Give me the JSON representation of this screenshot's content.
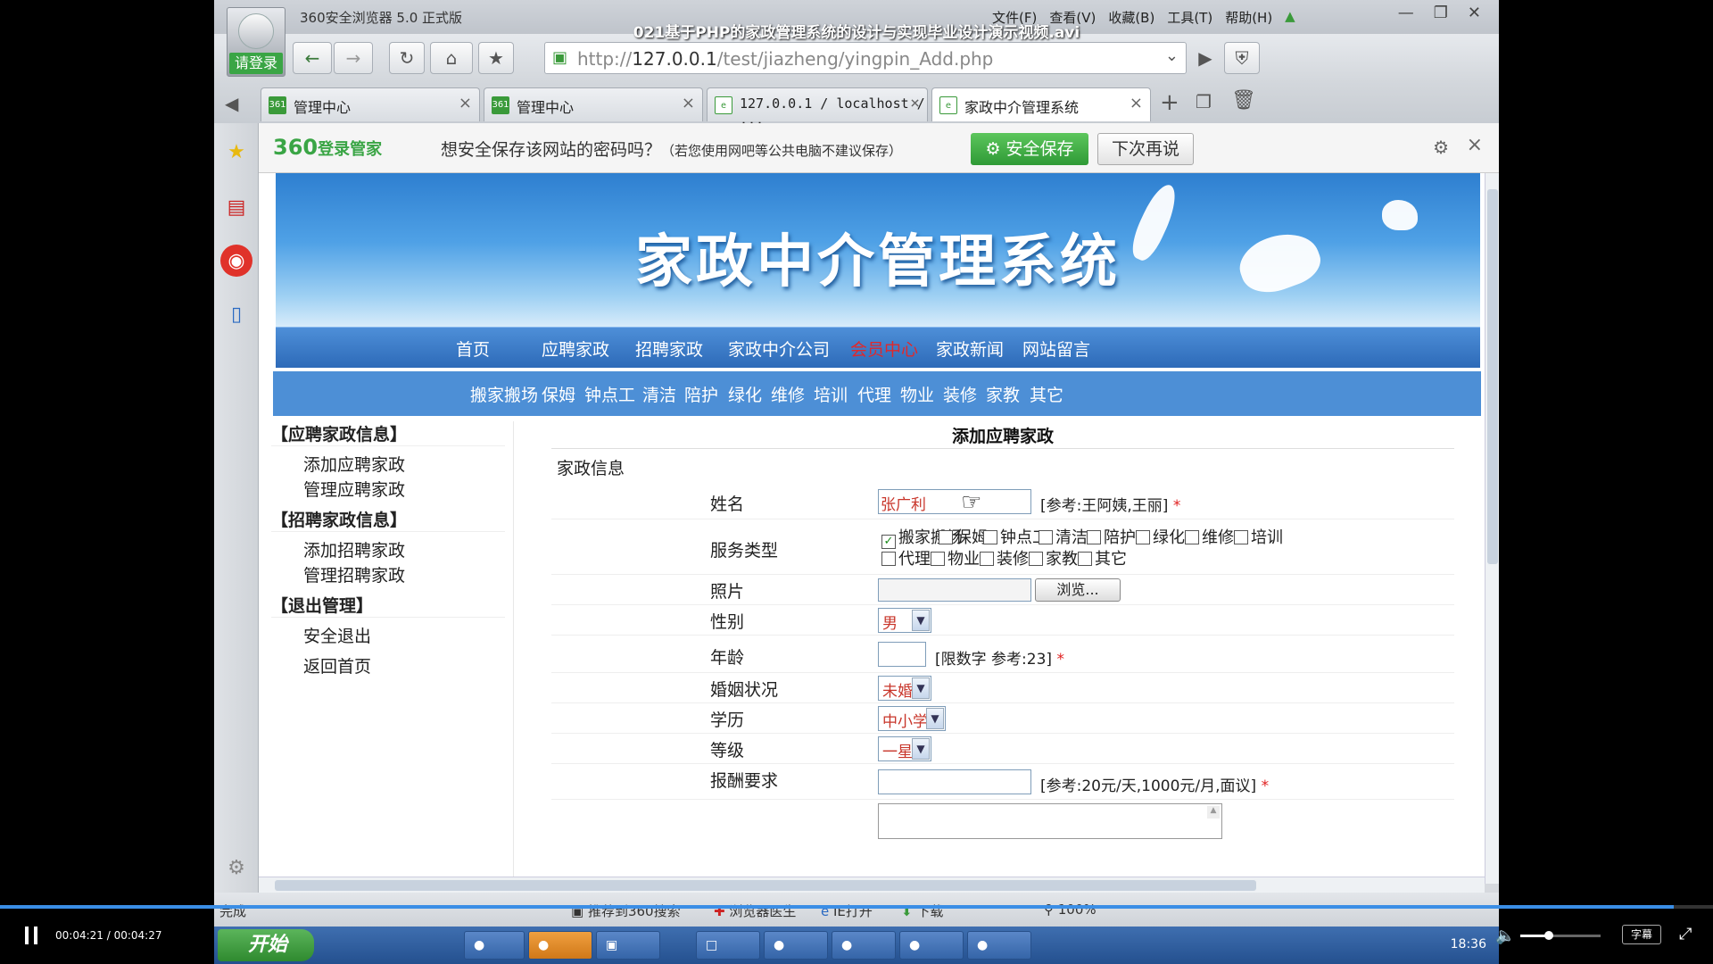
{
  "video": {
    "title": "021基于PHP的家政管理系统的设计与实现毕业设计演示视频.avi",
    "time": "00:04:21 / 00:04:27",
    "progress": 0.977,
    "volume": 0.35,
    "subtitle_label": "字幕"
  },
  "browser": {
    "name": "360安全浏览器 5.0 正式版",
    "login_label": "请登录",
    "menu": [
      "文件(F)",
      "查看(V)",
      "收藏(B)",
      "工具(T)",
      "帮助(H)"
    ],
    "url_prefix": "http://",
    "url_host": "127.0.0.1",
    "url_path": "/test/jiazheng/yingpin_Add.php",
    "tabs": [
      {
        "label": "管理中心"
      },
      {
        "label": "管理中心"
      },
      {
        "label": "127.0.0.1 / localhost / ..."
      },
      {
        "label": "家政中介管理系统"
      }
    ],
    "notify": {
      "brand": "360",
      "brand_sub": "登录管家",
      "message": "想安全保存该网站的密码吗？",
      "message_note": "（若您使用网吧等公共电脑不建议保存）",
      "save_label": "安全保存",
      "later_label": "下次再说"
    },
    "status": {
      "done": "完成",
      "items": [
        "推荐到360搜索",
        "浏览器医生",
        "IE打开",
        "下载",
        "100%"
      ]
    },
    "taskbar": {
      "start": "开始",
      "clock": "18:36"
    }
  },
  "site": {
    "banner_title": "家政中介管理系统",
    "nav": [
      "首页",
      "应聘家政",
      "招聘家政",
      "家政中介公司",
      "会员中心",
      "家政新闻",
      "网站留言"
    ],
    "nav_active": "会员中心",
    "subnav": [
      "搬家搬场",
      "保姆",
      "钟点工",
      "清洁",
      "陪护",
      "绿化",
      "维修",
      "培训",
      "代理",
      "物业",
      "装修",
      "家教",
      "其它"
    ]
  },
  "sidebar": {
    "sections": [
      {
        "title": "【应聘家政信息】",
        "links": [
          "添加应聘家政",
          "管理应聘家政"
        ]
      },
      {
        "title": "【招聘家政信息】",
        "links": [
          "添加招聘家政",
          "管理招聘家政"
        ]
      },
      {
        "title": "【退出管理】",
        "links": [
          "安全退出",
          "返回首页"
        ]
      }
    ]
  },
  "form": {
    "title": "添加应聘家政",
    "section": "家政信息",
    "name": {
      "label": "姓名",
      "value": "张广利",
      "hint": "[参考:王阿姨,王丽]",
      "required": "*"
    },
    "service": {
      "label": "服务类型",
      "options": [
        "搬家搬场",
        "保姆",
        "钟点工",
        "清洁",
        "陪护",
        "绿化",
        "维修",
        "培训",
        "代理",
        "物业",
        "装修",
        "家教",
        "其它"
      ],
      "checked": [
        "搬家搬场"
      ]
    },
    "photo": {
      "label": "照片",
      "value": "",
      "browse": "浏览..."
    },
    "gender": {
      "label": "性别",
      "value": "男"
    },
    "age": {
      "label": "年龄",
      "value": "",
      "hint": "[限数字 参考:23]",
      "required": "*"
    },
    "marital": {
      "label": "婚姻状况",
      "value": "未婚"
    },
    "education": {
      "label": "学历",
      "value": "中小学"
    },
    "level": {
      "label": "等级",
      "value": "一星"
    },
    "salary": {
      "label": "报酬要求",
      "value": "",
      "hint": "[参考:20元/天,1000元/月,面议]",
      "required": "*"
    }
  },
  "colors": {
    "nav_active": "#e0282b",
    "required_star": "#e01f1f",
    "nav_bg": "#2d6ab8",
    "subnav_bg": "#4d8fd6",
    "accent_green": "#3aa545"
  }
}
